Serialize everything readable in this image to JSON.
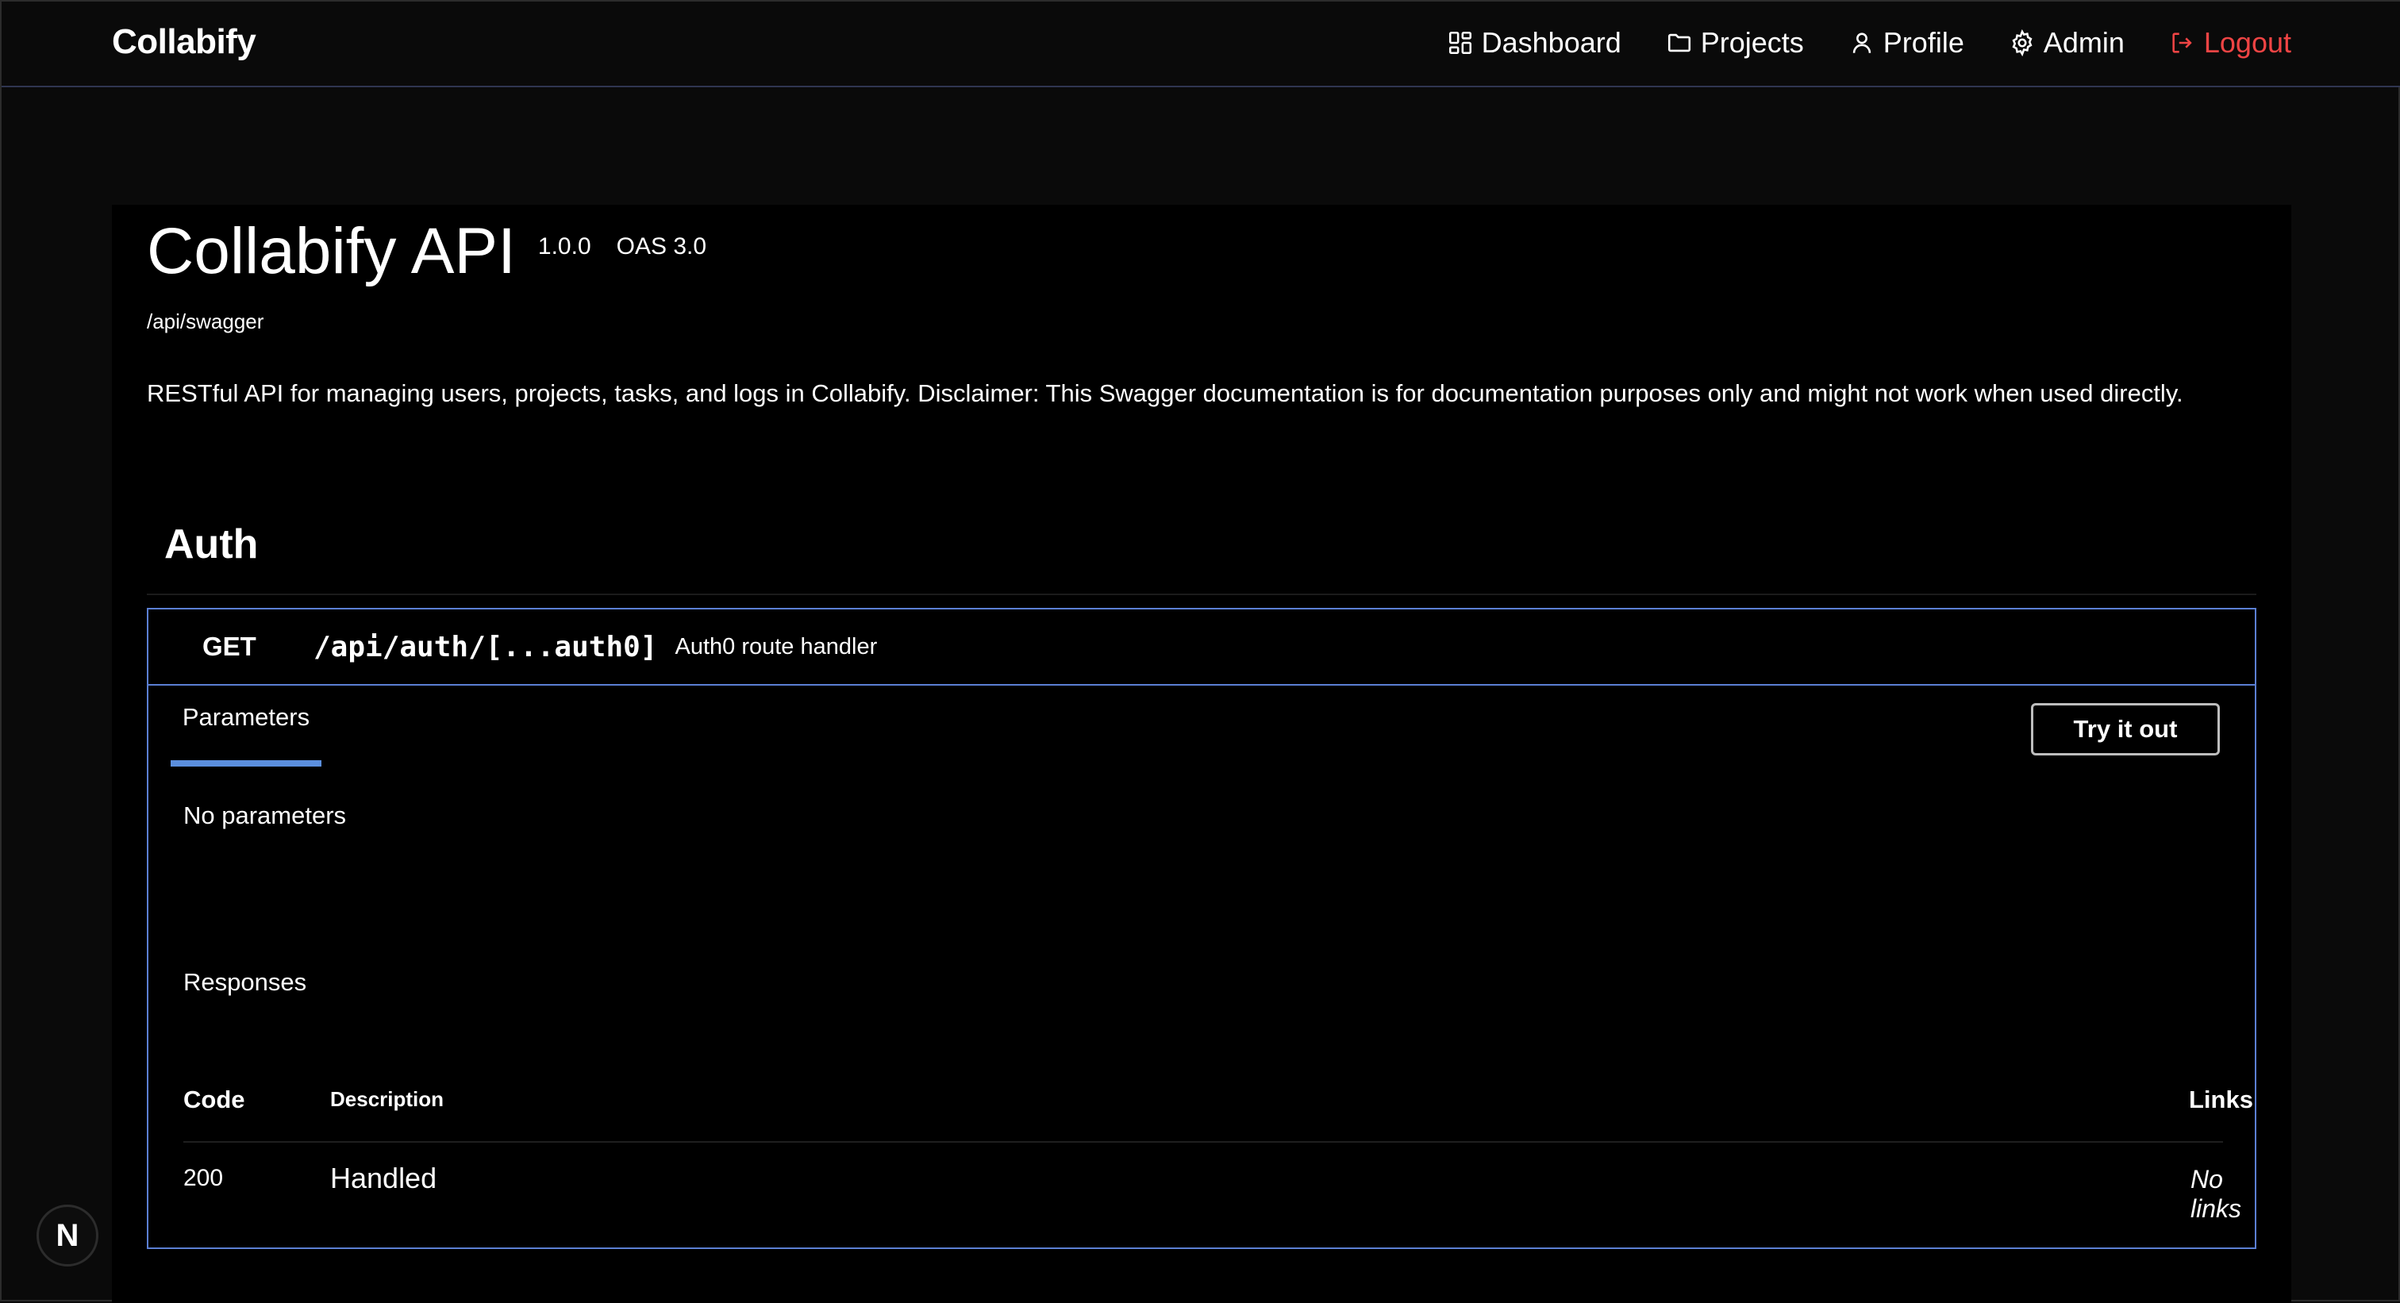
{
  "app": {
    "brand": "Collabify"
  },
  "nav": {
    "items": [
      {
        "label": "Dashboard",
        "icon": "dashboard-icon"
      },
      {
        "label": "Projects",
        "icon": "folder-icon"
      },
      {
        "label": "Profile",
        "icon": "user-icon"
      },
      {
        "label": "Admin",
        "icon": "gear-icon"
      },
      {
        "label": "Logout",
        "icon": "logout-icon"
      }
    ]
  },
  "colors": {
    "logout": "#ef4444",
    "accent_border": "#5b7fd3",
    "tab_underline": "#5b8fde"
  },
  "api": {
    "title": "Collabify API",
    "version": "1.0.0",
    "oas": "OAS 3.0",
    "url": "/api/swagger",
    "description": "RESTful API for managing users, projects, tasks, and logs in Collabify. Disclaimer: This Swagger documentation is for documentation purposes only and might not work when used directly."
  },
  "tag": {
    "name": "Auth",
    "operation": {
      "method": "GET",
      "path": "/api/auth/[...auth0]",
      "summary": "Auth0 route handler",
      "tab_label": "Parameters",
      "try_label": "Try it out",
      "no_params": "No parameters",
      "responses_label": "Responses",
      "table": {
        "headers": {
          "code": "Code",
          "description": "Description",
          "links": "Links"
        },
        "rows": [
          {
            "code": "200",
            "description": "Handled",
            "links": "No links"
          }
        ]
      }
    }
  },
  "badge": {
    "label": "N"
  }
}
